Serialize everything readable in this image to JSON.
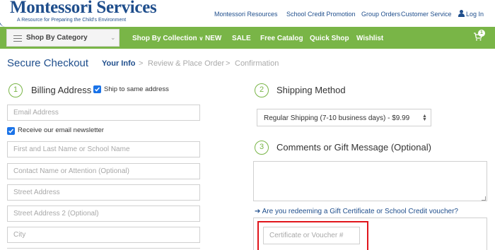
{
  "header": {
    "logo": "Montessori Services",
    "tagline": "A Resource for Preparing the Child's Environment",
    "links": [
      "Montessori Resources",
      "School Credit Promotion",
      "Group Orders",
      "Customer Service"
    ],
    "login": "Log In"
  },
  "nav": {
    "category_button": "Shop By Category",
    "collection": "Shop By Collection",
    "items": [
      "NEW",
      "SALE",
      "Free Catalog",
      "Quick Shop",
      "Wishlist"
    ],
    "cart_count": "1"
  },
  "checkout": {
    "title": "Secure Checkout",
    "steps": [
      "Your Info",
      "Review & Place Order",
      "Confirmation"
    ],
    "separator": ">"
  },
  "billing": {
    "step": "1",
    "title": "Billing Address",
    "ship_same_label": "Ship to same address",
    "email_placeholder": "Email Address",
    "newsletter_label": "Receive our email newsletter",
    "name_placeholder": "First and Last Name or School Name",
    "contact_placeholder": "Contact Name or Attention (Optional)",
    "street_placeholder": "Street Address",
    "street2_placeholder": "Street Address 2 (Optional)",
    "city_placeholder": "City"
  },
  "shipping": {
    "step": "2",
    "title": "Shipping Method",
    "selected": "Regular Shipping (7-10 business days) - $9.99"
  },
  "comments": {
    "step": "3",
    "title": "Comments or Gift Message (Optional)"
  },
  "voucher": {
    "question": "Are you redeeming a Gift Certificate or School Credit voucher?",
    "placeholder": "Certificate or Voucher #"
  },
  "colors": {
    "brand_blue": "#1f4e8c",
    "nav_green": "#79b547",
    "checkbox_blue": "#1a73e8",
    "highlight_red": "#e0151b"
  }
}
